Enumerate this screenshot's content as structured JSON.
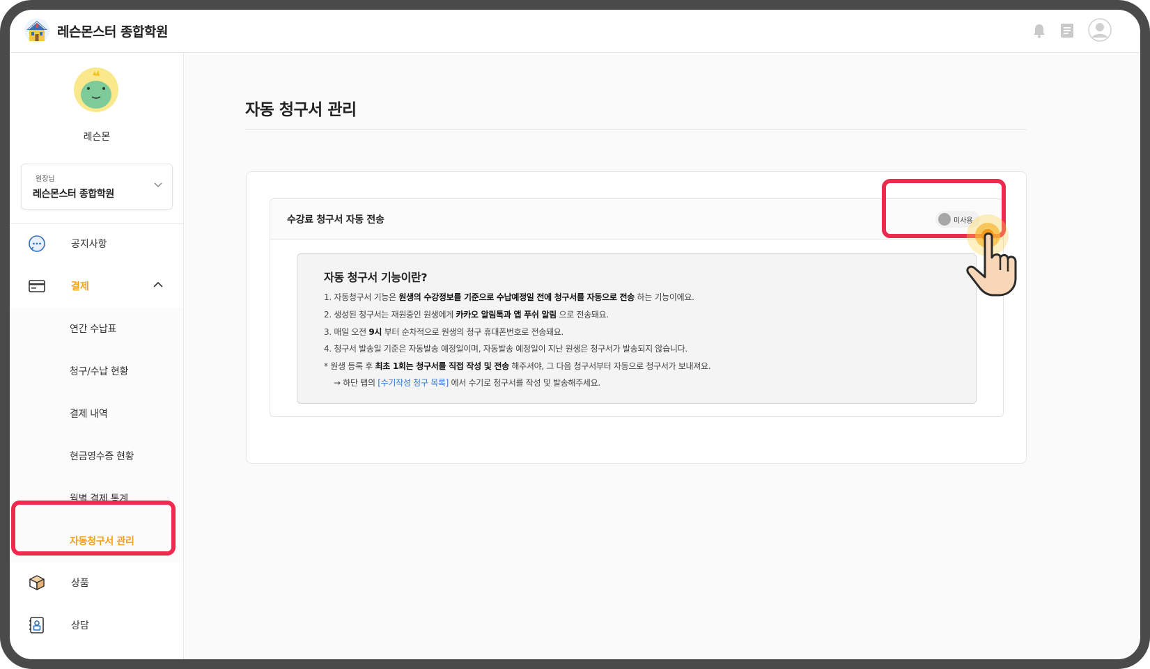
{
  "header": {
    "brand": "레슨몬스터 종합학원"
  },
  "sidebar": {
    "profile_name": "레슨몬",
    "academy": {
      "role": "원장님",
      "name": "레슨몬스터 종합학원"
    },
    "nav": [
      {
        "label": "공지사항",
        "icon": "chat-bubble-icon"
      },
      {
        "label": "결제",
        "icon": "card-icon",
        "active": true,
        "expanded": true
      },
      {
        "label": "상품",
        "icon": "box-icon"
      },
      {
        "label": "상담",
        "icon": "contact-icon"
      }
    ],
    "payment_sub": [
      {
        "label": "연간 수납표"
      },
      {
        "label": "청구/수납 현황"
      },
      {
        "label": "결제 내역"
      },
      {
        "label": "현금영수증 현황"
      },
      {
        "label": "월별 결제 통계"
      },
      {
        "label": "자동청구서 관리",
        "active": true
      }
    ]
  },
  "main": {
    "page_title": "자동 청구서 관리",
    "setting": {
      "title": "수강료 청구서 자동 전송",
      "toggle_label": "미사용"
    },
    "info": {
      "title": "자동 청구서 기능이란?",
      "l1a": "1. 자동청구서 기능은 ",
      "l1b": "원생의 수강정보를 기준으로 수납예정일 전에 청구서를 자동으로 전송",
      "l1c": " 하는 기능이에요.",
      "l2a": "2. 생성된 청구서는 재원중인 원생에게 ",
      "l2b": "카카오 알림톡과 앱 푸쉬 알림",
      "l2c": " 으로 전송돼요.",
      "l3a": "3. 매일 오전 ",
      "l3b": "9시",
      "l3c": " 부터 순차적으로 원생의 청구 휴대폰번호로 전송돼요.",
      "l4": "4. 청구서 발송일 기준은 자동발송 예정일이며, 자동발송 예정일이 지난 원생은 청구서가 발송되지 않습니다.",
      "l5a": "* 원생 등록 후 ",
      "l5b": "최초 1회는 청구서를 직접 작성 및 전송",
      "l5c": " 해주셔야, 그 다음 청구서부터 자동으로 청구서가 보내져요.",
      "l6a": "→ 하단 탭의 ",
      "l6b": "[수기작성 청구 목록]",
      "l6c": " 에서 수기로 청구서를 작성 및 발송해주세요."
    }
  },
  "colors": {
    "accent": "#f2a114",
    "highlight": "#ee2a4e",
    "link": "#2f78d8"
  }
}
